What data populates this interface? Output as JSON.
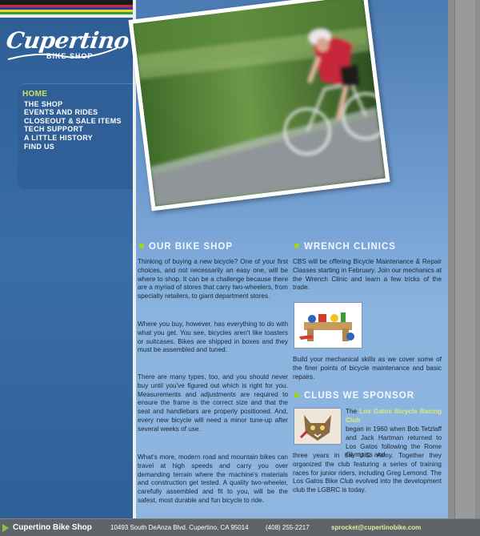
{
  "brand": {
    "logo_main": "Cupertino",
    "logo_sub": "BIKE SHOP",
    "stripe_colors": [
      "#1a1a1a",
      "#d12828",
      "#1f3fb3",
      "#f1d424",
      "#3a9d3a"
    ]
  },
  "nav": {
    "items": [
      {
        "label": "HOME",
        "active": true
      },
      {
        "label": "THE SHOP"
      },
      {
        "label": "EVENTS AND RIDES"
      },
      {
        "label": "CLOSEOUT & SALE ITEMS"
      },
      {
        "label": "TECH SUPPORT"
      },
      {
        "label": "A LITTLE HISTORY"
      },
      {
        "label": "FIND US"
      }
    ]
  },
  "sections": {
    "our_bike_shop": {
      "title": "OUR BIKE SHOP",
      "p1": "Thinking of buying a new bicycle? One of your first choices, and not necessarily an easy one, will be where to shop. It can be a challenge because there are a myriad of stores that carry two-wheelers, from specialty retailers, to giant department stores.",
      "p2": "Where you buy, however, has everything to do with what you get. You see, bicycles aren't like toasters or suitcases. Bikes are shipped in boxes and they must be assembled and tuned.",
      "p3": "There are many types, too, and you should never buy until you've figured out which is right for you. Measurements and adjustments are required to ensure the frame is the correct size and that the seat and handlebars are properly positioned. And, every new bicycle will need a minor tune-up after several weeks of use.",
      "p4": "What's more, modern road and mountain bikes can travel at high speeds and carry you over demanding terrain where the machine's materials and construction get tested. A quality two-wheeler, carefully assembled and fit to you, will be the safest, most durable and fun bicycle to ride."
    },
    "wrench_clinics": {
      "title": "WRENCH CLINICS",
      "p1": "CBS will be offering Bicycle Maintenance & Repair Classes starting in February. Join our mechanics at the Wrench Clinic and learn a few tricks of the trade.",
      "p2": "Build your mechanical skills as we cover some of the finer points of bicycle maintenance and basic repairs."
    },
    "clubs": {
      "title": "CLUBS WE SPONSOR",
      "link": "Los Gatos Bicycle Racing Club",
      "pre": "The ",
      "text": " began in 1960 when Bob Tetzlaff and Jack Hartman returned to Los Gatos following the Rome Olympics and three years in the U.S. Army. Together they organized the club featuring a series of training races for junior riders, including Greg Lemond. The Los Gatos Bike Club evolved into the development club the LGBRC is today."
    }
  },
  "footer": {
    "name": "Cupertino Bike Shop",
    "address": "10493 South DeAnza Blvd. Cupertino, CA 95014",
    "phone": "(408) 255-2217",
    "email": "sprocket@cupertinobike.com"
  }
}
